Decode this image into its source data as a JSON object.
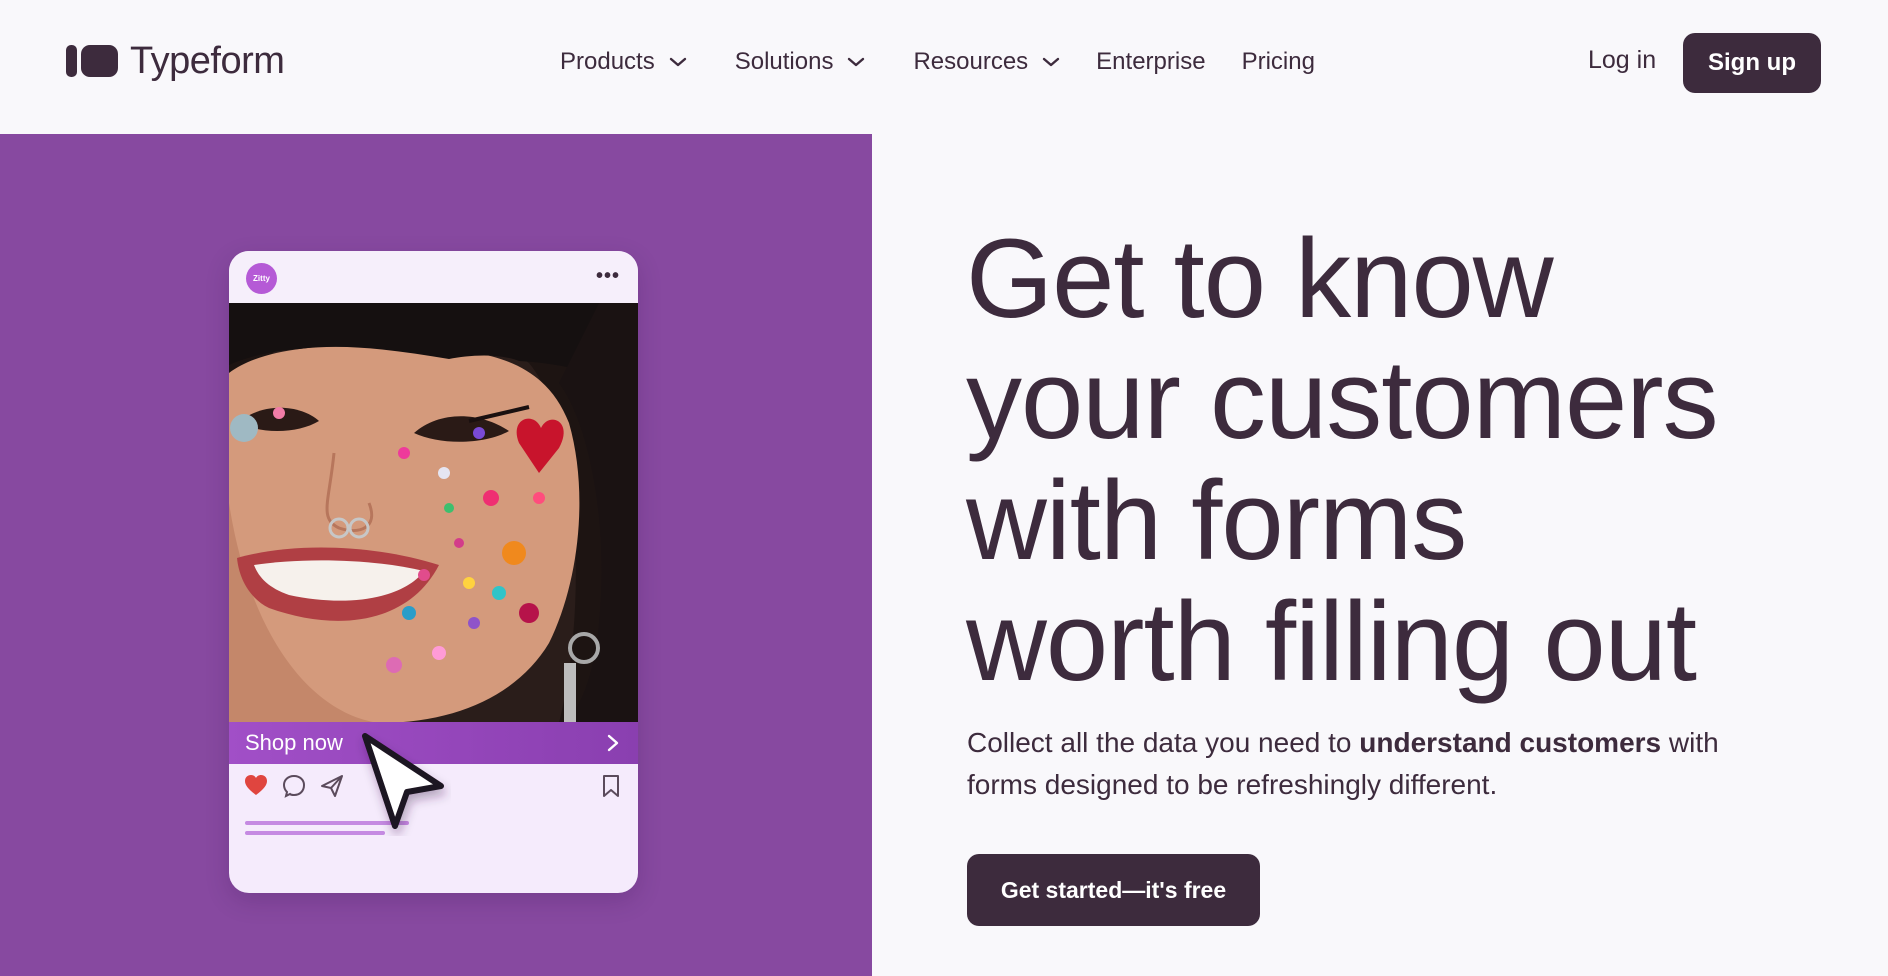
{
  "header": {
    "logo_text": "Typeform",
    "nav": [
      {
        "label": "Products",
        "has_dropdown": true
      },
      {
        "label": "Solutions",
        "has_dropdown": true
      },
      {
        "label": "Resources",
        "has_dropdown": true
      },
      {
        "label": "Enterprise",
        "has_dropdown": false
      },
      {
        "label": "Pricing",
        "has_dropdown": false
      }
    ],
    "login_label": "Log in",
    "signup_label": "Sign up"
  },
  "hero": {
    "headline_lines": [
      "Get to know",
      "your customers",
      "with forms",
      "worth filling out"
    ],
    "subhead_before": "Collect all the data you need to ",
    "subhead_bold": "understand customers",
    "subhead_after": " with forms designed to be refreshingly different.",
    "cta_label": "Get started—it's free"
  },
  "preview_card": {
    "brand_avatar_text": "Zitty",
    "more_icon": "more-dots-icon",
    "shop_label": "Shop now",
    "icons": [
      "heart-icon",
      "comment-icon",
      "send-icon",
      "bookmark-icon",
      "chevron-right-icon",
      "cursor-icon"
    ]
  },
  "colors": {
    "brand_dark": "#3d2b3d",
    "hero_purple": "#8749a0",
    "page_bg": "#f9f8fb",
    "card_bg": "#f5ebfc",
    "shop_bar": "#a14fc7",
    "heart": "#e0453f"
  }
}
